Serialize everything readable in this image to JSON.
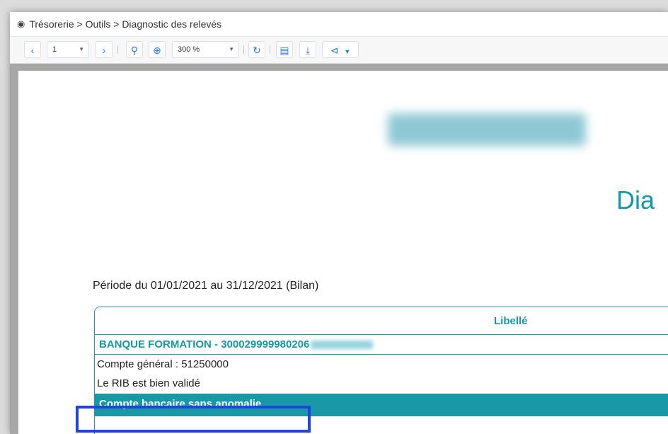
{
  "breadcrumb": {
    "icon": "eye-icon",
    "text": "Trésorerie > Outils > Diagnostic des relevés"
  },
  "toolbar": {
    "prev_icon": "chevron-left-icon",
    "page_value": "1",
    "next_icon": "chevron-right-icon",
    "zoom_out_icon": "zoom-out-icon",
    "zoom_in_icon": "zoom-in-icon",
    "zoom_value": "300 %",
    "refresh_icon": "refresh-icon",
    "print_icon": "print-icon",
    "download_icon": "download-icon",
    "share_icon": "share-icon"
  },
  "report": {
    "title_partial": "Dia",
    "periode": "Période du 01/01/2021 au 31/12/2021 (Bilan)",
    "table_header": "Libellé",
    "bank_row": "BANQUE FORMATION - 300029999980206",
    "compte_general": "Compte général : 51250000",
    "rib_status": "Le RIB est bien validé",
    "status_row": "Compte bancaire sans anomalie"
  },
  "colors": {
    "accent": "#1598a5",
    "highlight": "#1f43e6",
    "toolbar_icon": "#2a7be4"
  }
}
